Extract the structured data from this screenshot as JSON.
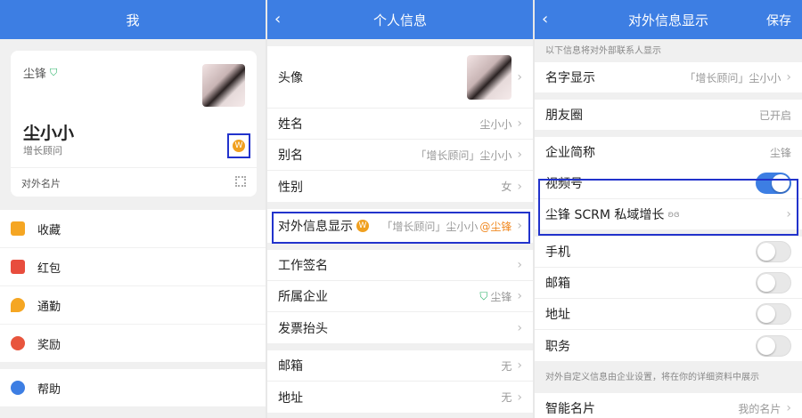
{
  "panel1": {
    "title": "我",
    "company": "尘锋",
    "name": "尘小小",
    "role": "增长顾问",
    "card_label": "对外名片",
    "menu": [
      {
        "label": "收藏",
        "icon": "box-icon",
        "color": "#f5a623"
      },
      {
        "label": "红包",
        "icon": "red-envelope-icon",
        "color": "#e84d3d"
      },
      {
        "label": "通勤",
        "icon": "location-pin-icon",
        "color": "#f5a623"
      },
      {
        "label": "奖励",
        "icon": "medal-icon",
        "color": "#e8553d"
      },
      {
        "label": "帮助",
        "icon": "chat-bubble-icon",
        "color": "#3d7ee3"
      }
    ]
  },
  "panel2": {
    "title": "个人信息",
    "rows": [
      {
        "label": "头像",
        "value": ""
      },
      {
        "label": "姓名",
        "value": "尘小小"
      },
      {
        "label": "别名",
        "value": "「增长顾问」尘小小"
      },
      {
        "label": "性别",
        "value": "女"
      },
      {
        "label": "对外信息显示",
        "value": "「增长顾问」尘小小",
        "suffix": "@尘锋"
      },
      {
        "label": "工作签名",
        "value": ""
      },
      {
        "label": "所属企业",
        "value": "尘锋"
      },
      {
        "label": "发票抬头",
        "value": ""
      },
      {
        "label": "邮箱",
        "value": "无"
      },
      {
        "label": "地址",
        "value": "无"
      }
    ]
  },
  "panel3": {
    "title": "对外信息显示",
    "save_label": "保存",
    "note_top": "以下信息将对外部联系人显示",
    "rows": [
      {
        "label": "名字显示",
        "value": "「增长顾问」尘小小"
      },
      {
        "label": "朋友圈",
        "value": "已开启"
      },
      {
        "label": "企业简称",
        "value": "尘锋"
      },
      {
        "label": "视频号",
        "toggle": true
      },
      {
        "label": "尘锋 SCRM 私域增长",
        "value": ""
      },
      {
        "label": "手机",
        "toggle": false
      },
      {
        "label": "邮箱",
        "toggle": false
      },
      {
        "label": "地址",
        "toggle": false
      },
      {
        "label": "职务",
        "toggle": false
      }
    ],
    "note_bottom": "对外自定义信息由企业设置，将在你的详细资料中展示",
    "bottom_row_label": "智能名片",
    "bottom_row_value": "我的名片"
  }
}
